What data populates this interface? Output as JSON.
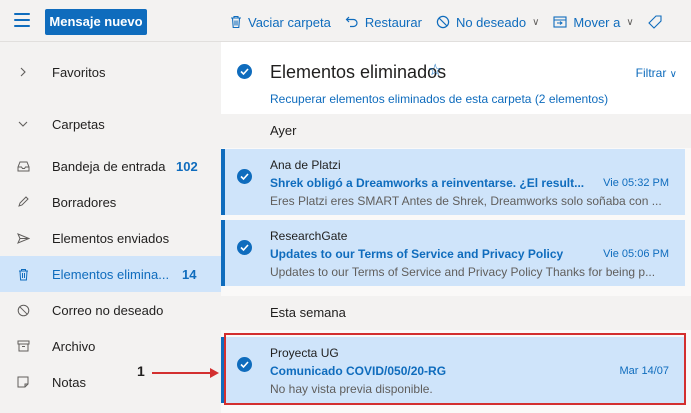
{
  "toolbar": {
    "new_message": "Mensaje nuevo",
    "empty_folder": "Vaciar carpeta",
    "restore": "Restaurar",
    "junk": "No deseado",
    "move_to": "Mover a"
  },
  "sidebar": {
    "favorites": "Favoritos",
    "folders": "Carpetas",
    "items": [
      {
        "label": "Bandeja de entrada",
        "count": "102",
        "icon": "inbox-icon"
      },
      {
        "label": "Borradores",
        "count": "",
        "icon": "pencil-icon"
      },
      {
        "label": "Elementos enviados",
        "count": "",
        "icon": "send-icon"
      },
      {
        "label": "Elementos elimina...",
        "count": "14",
        "icon": "trash-icon"
      },
      {
        "label": "Correo no deseado",
        "count": "",
        "icon": "block-icon"
      },
      {
        "label": "Archivo",
        "count": "",
        "icon": "archive-icon"
      },
      {
        "label": "Notas",
        "count": "",
        "icon": "note-icon"
      }
    ]
  },
  "folder": {
    "title": "Elementos eliminados",
    "filter": "Filtrar",
    "recover": "Recuperar elementos eliminados de esta carpeta (2 elementos)"
  },
  "groups": [
    "Ayer",
    "Esta semana"
  ],
  "messages": [
    {
      "sender": "Ana de Platzi",
      "subject": "Shrek obligó a Dreamworks a reinventarse. ¿El result...",
      "date": "Vie 05:32 PM",
      "preview": "Eres Platzi eres SMART Antes de Shrek, Dreamworks solo soñaba con ..."
    },
    {
      "sender": "ResearchGate",
      "subject": "Updates to our Terms of Service and Privacy Policy",
      "date": "Vie 05:06 PM",
      "preview": "Updates to our Terms of Service and Privacy Policy Thanks for being p..."
    },
    {
      "sender": "Proyecta UG",
      "subject": "Comunicado COVID/050/20-RG",
      "date": "Mar 14/07",
      "preview": "No hay vista previa disponible."
    }
  ],
  "annotation": {
    "label": "1"
  },
  "colors": {
    "accent": "#0f6cbd",
    "selected": "#cfe4fa",
    "highlight": "#d32f2f"
  }
}
